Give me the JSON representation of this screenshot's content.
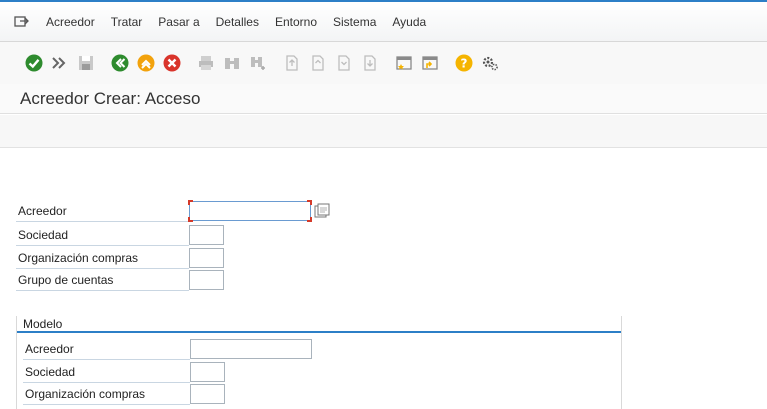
{
  "menubar": {
    "items": [
      {
        "label": "Acreedor"
      },
      {
        "label": "Tratar"
      },
      {
        "label": "Pasar a"
      },
      {
        "label": "Detalles"
      },
      {
        "label": "Entorno"
      },
      {
        "label": "Sistema"
      },
      {
        "label": "Ayuda"
      }
    ]
  },
  "toolbar": {
    "icons": [
      "check-icon",
      "command-field-icon",
      "save-icon",
      "back-icon",
      "exit-icon",
      "cancel-icon",
      "print-icon",
      "find-icon",
      "find-next-icon",
      "first-page-icon",
      "previous-page-icon",
      "next-page-icon",
      "last-page-icon",
      "create-session-icon",
      "shortcut-icon",
      "help-icon",
      "settings-icon"
    ]
  },
  "title": "Acreedor Crear: Acceso",
  "form": {
    "fields": [
      {
        "label": "Acreedor",
        "value": ""
      },
      {
        "label": "Sociedad",
        "value": ""
      },
      {
        "label": "Organización compras",
        "value": ""
      },
      {
        "label": "Grupo de cuentas",
        "value": ""
      }
    ]
  },
  "modelo": {
    "title": "Modelo",
    "fields": [
      {
        "label": "Acreedor",
        "value": ""
      },
      {
        "label": "Sociedad",
        "value": ""
      },
      {
        "label": "Organización compras",
        "value": ""
      }
    ]
  },
  "colors": {
    "accent": "#2c7fc7",
    "ok_green": "#2e8b2e",
    "cancel_red": "#d9342b",
    "exit_orange": "#f2a20c",
    "help_yellow": "#f5b400"
  }
}
